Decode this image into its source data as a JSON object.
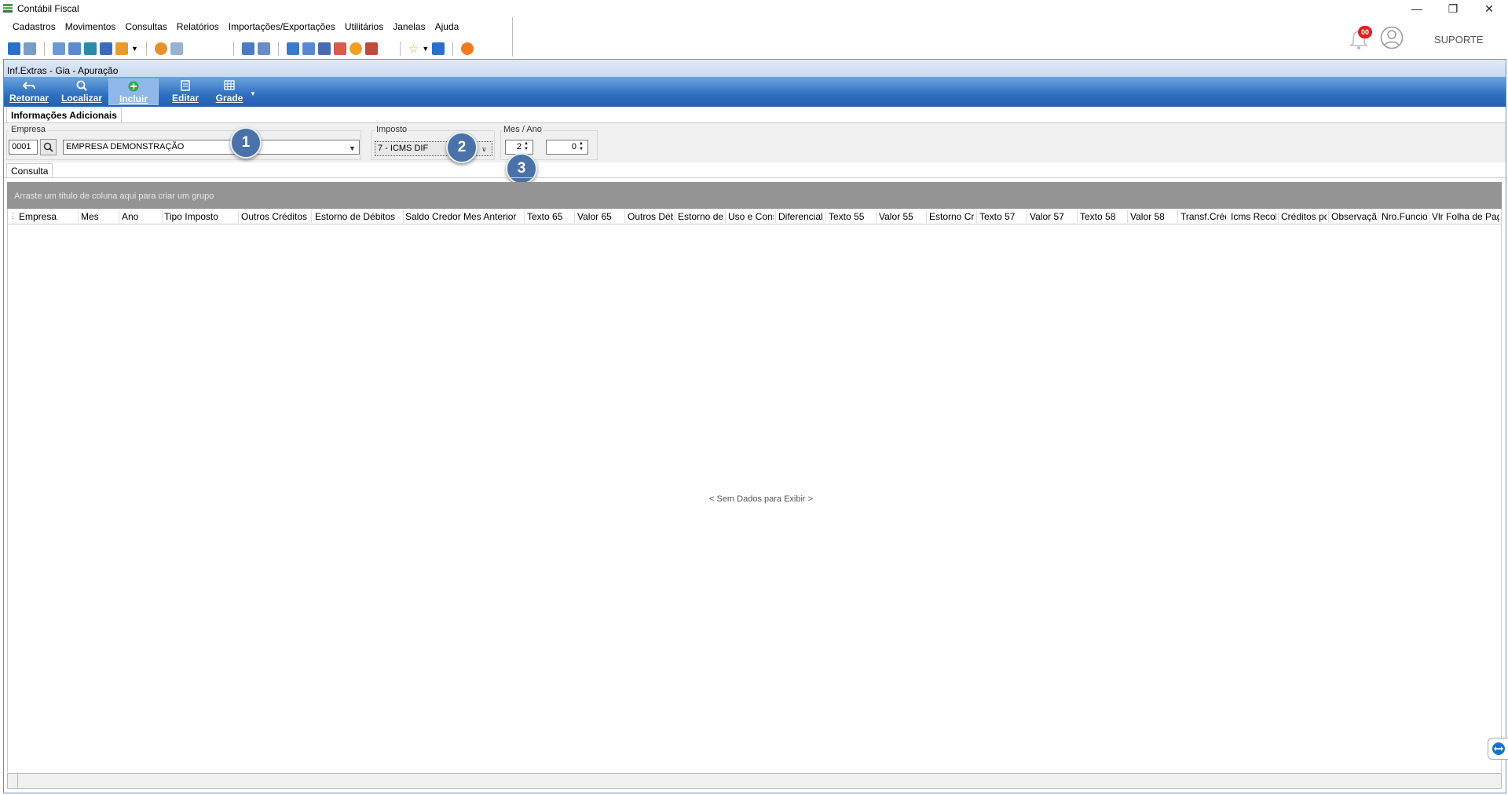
{
  "app": {
    "title": "Contábil Fiscal",
    "user": "SUPORTE",
    "notifications": "00"
  },
  "menu": [
    "Cadastros",
    "Movimentos",
    "Consultas",
    "Relatórios",
    "Importações/Exportações",
    "Utilitários",
    "Janelas",
    "Ajuda"
  ],
  "window": {
    "title": "Inf.Extras - Gia - Apuração"
  },
  "ribbon": {
    "retornar": "Retornar",
    "localizar": "Localizar",
    "incluir": "Incluir",
    "editar": "Editar",
    "grade": "Grade"
  },
  "tabs": {
    "info": "Informações Adicionais",
    "consulta": "Consulta"
  },
  "filters": {
    "empresa_label": "Empresa",
    "empresa_code": "0001",
    "empresa_name": "EMPRESA DEMONSTRAÇÃO",
    "imposto_label": "Imposto",
    "imposto_value": "7 - ICMS DIF",
    "mesano_label": "Mes / Ano",
    "mes_value": "2",
    "ano_value": "0"
  },
  "badges": [
    "1",
    "2",
    "3"
  ],
  "grid": {
    "group_hint": "Arraste um título de coluna aqui para criar um grupo",
    "columns": [
      "Empresa",
      "Mes",
      "Ano",
      "Tipo Imposto",
      "Outros Créditos",
      "Estorno de Débitos",
      "Saldo Credor Mes Anterior",
      "Texto 65",
      "Valor 65",
      "Outros Débit",
      "Estorno de C",
      "Uso e Consu",
      "Diferencial d",
      "Texto 55",
      "Valor 55",
      "Estorno Créd",
      "Texto 57",
      "Valor 57",
      "Texto 58",
      "Valor 58",
      "Transf.Crédi",
      "Icms Recolh",
      "Créditos por",
      "Observação",
      "Nro.Funcion",
      "Vlr Folha de Pagto"
    ],
    "no_data": "< Sem Dados para Exibir >"
  },
  "colors": {
    "ribbon": "#2f6fc1",
    "badge": "#4a72a8",
    "group_panel": "#949494"
  }
}
